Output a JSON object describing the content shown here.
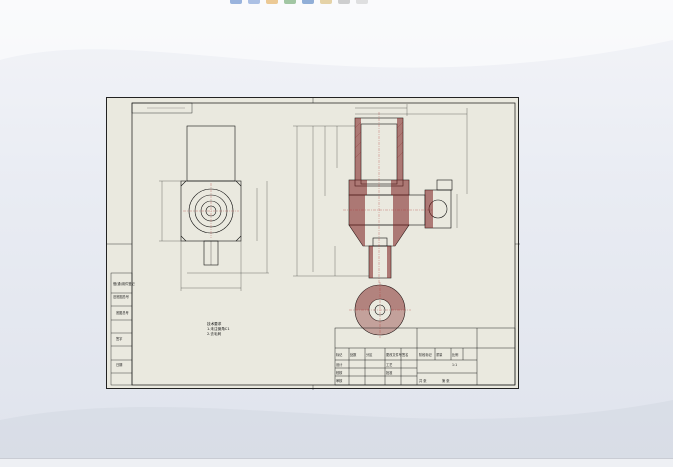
{
  "window": {
    "toolbar_icons": [
      "zoom-icon",
      "pan-icon",
      "view-orientation-icon",
      "display-style-icon",
      "section-view-icon",
      "hide-show-icon",
      "appearance-icon",
      "scene-icon"
    ],
    "accent_color": "#1f5fb0"
  },
  "sheet": {
    "paper_color": "#eae9df",
    "line_color": "#111111",
    "hatch_color": "#7a1d1d",
    "dimension_color": "#1a1a1a",
    "title_label": "",
    "notes": [
      "技术要求",
      "1.未注倒角C1",
      "2.去毛刺"
    ],
    "title_block": {
      "part_name": "",
      "material": "",
      "scale": "1:1",
      "sheet_label": "",
      "headers": [
        "标记",
        "处数",
        "分区",
        "更改文件号",
        "签名",
        "年月日"
      ],
      "rows": [
        "设计",
        "校核",
        "审核",
        "工艺",
        "批准"
      ],
      "right_cells": [
        "阶段标记",
        "重量",
        "比例",
        "共 张",
        "第 张"
      ]
    },
    "left_strip": [
      "借(通)用件登记",
      "旧底图总号",
      "底图总号",
      "签字",
      "日期"
    ]
  }
}
